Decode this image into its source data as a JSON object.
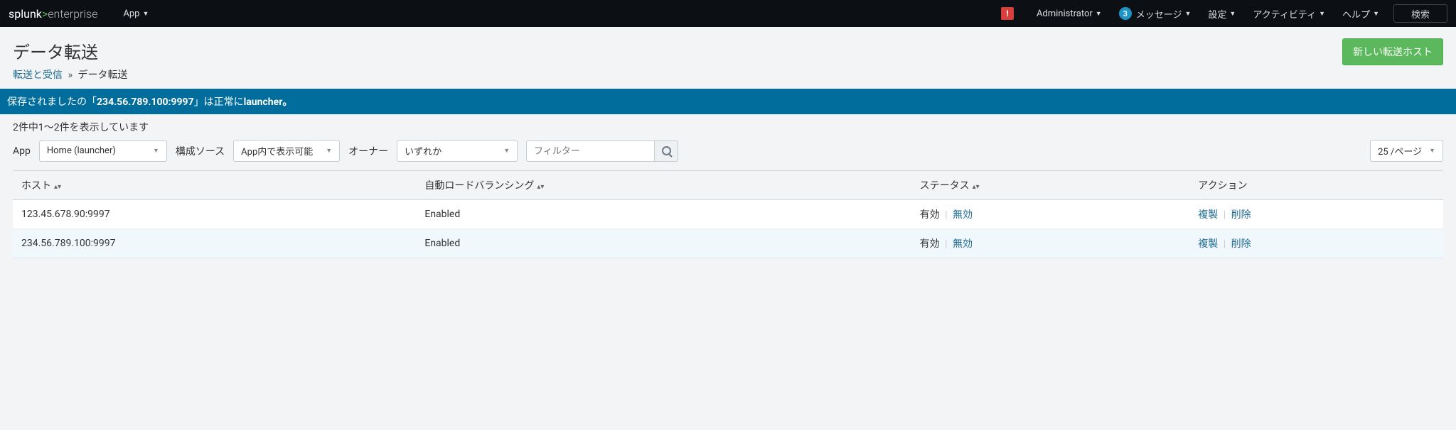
{
  "brand": {
    "pre": "splunk",
    "post": "enterprise"
  },
  "topnav": {
    "app": "App",
    "admin": "Administrator",
    "messages_count": "3",
    "messages": "メッセージ",
    "settings": "設定",
    "activity": "アクティビティ",
    "help": "ヘルプ",
    "search": "検索"
  },
  "page": {
    "title": "データ転送",
    "breadcrumb_link": "転送と受信",
    "breadcrumb_sep": "»",
    "breadcrumb_current": "データ転送",
    "new_button": "新しい転送ホスト"
  },
  "banner": {
    "prefix": "保存されましたの「",
    "bold": "234.56.789.100:9997",
    "mid": "」は正常に",
    "suffix": "launcher。"
  },
  "count_text": "2件中1〜2件を表示しています",
  "filters": {
    "app_label": "App",
    "app_value": "Home (launcher)",
    "source_label": "構成ソース",
    "source_value": "App内で表示可能",
    "owner_label": "オーナー",
    "owner_value": "いずれか",
    "filter_placeholder": "フィルター",
    "per_page": "25 /ページ"
  },
  "table": {
    "headers": {
      "host": "ホスト",
      "autolb": "自動ロードバランシング",
      "status": "ステータス",
      "action": "アクション"
    },
    "rows": [
      {
        "host": "123.45.678.90:9997",
        "autolb": "Enabled",
        "status_text": "有効",
        "status_link": "無効",
        "action_clone": "複製",
        "action_delete": "削除"
      },
      {
        "host": "234.56.789.100:9997",
        "autolb": "Enabled",
        "status_text": "有効",
        "status_link": "無効",
        "action_clone": "複製",
        "action_delete": "削除"
      }
    ]
  }
}
